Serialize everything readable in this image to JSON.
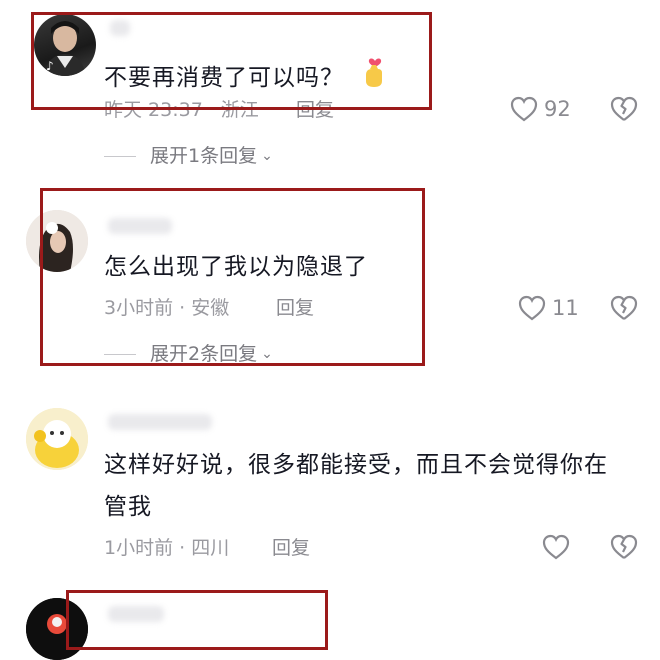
{
  "comments": [
    {
      "text": "不要再消费了可以吗？",
      "emoji": "🫰",
      "time": "昨天 23:37",
      "location": "浙江",
      "reply_label": "回复",
      "likes": "92",
      "expand_label": "展开1条回复",
      "highlighted": true
    },
    {
      "text": "怎么出现了我以为隐退了",
      "time": "3小时前",
      "location": "安徽",
      "reply_label": "回复",
      "likes": "11",
      "expand_label": "展开2条回复",
      "highlighted": true
    },
    {
      "text_line1": "这样好好说，很多都能接受，而且不会觉得你在",
      "text_line2": "管我",
      "time": "1小时前",
      "location": "四川",
      "reply_label": "回复",
      "likes": "",
      "highlighted": false
    },
    {
      "text": "",
      "highlighted": true
    }
  ],
  "meta_separator": " · ",
  "colors": {
    "highlight_border": "#9b1a1a",
    "text": "#161823",
    "meta": "#9a9aa0"
  }
}
